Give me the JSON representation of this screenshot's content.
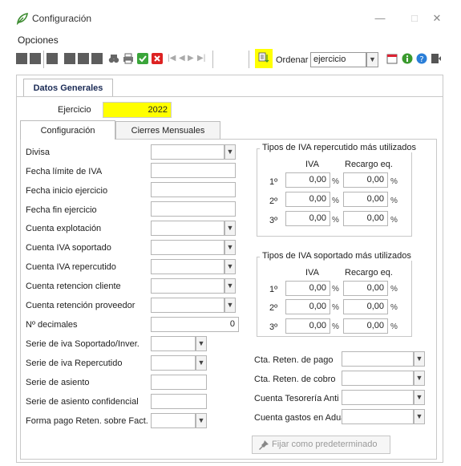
{
  "window": {
    "title": "Configuración",
    "minimize": "—",
    "maximize": "□",
    "close": "✕"
  },
  "menu": {
    "opciones": "Opciones"
  },
  "toolbar": {
    "ordenar_label": "Ordenar",
    "ordenar_value": "ejercicio",
    "highlight_color": "#ffff00"
  },
  "tabs": {
    "datos_generales": "Datos Generales",
    "configuracion": "Configuración",
    "cierres_mensuales": "Cierres Mensuales"
  },
  "ejercicio": {
    "label": "Ejercicio",
    "value": "2022"
  },
  "fields": [
    {
      "label": "Divisa",
      "value": "",
      "kind": "combo"
    },
    {
      "label": "Fecha límite de IVA",
      "value": "",
      "kind": "text"
    },
    {
      "label": "Fecha inicio ejercicio",
      "value": "",
      "kind": "text"
    },
    {
      "label": "Fecha fin ejercicio",
      "value": "",
      "kind": "text"
    },
    {
      "label": "Cuenta explotación",
      "value": "",
      "kind": "combo"
    },
    {
      "label": "Cuenta IVA soportado",
      "value": "",
      "kind": "combo"
    },
    {
      "label": "Cuenta IVA repercutido",
      "value": "",
      "kind": "combo"
    },
    {
      "label": "Cuenta retencion cliente",
      "value": "",
      "kind": "combo"
    },
    {
      "label": "Cuenta retención proveedor",
      "value": "",
      "kind": "combo"
    },
    {
      "label": "Nº decimales",
      "value": "0",
      "kind": "number"
    }
  ],
  "series": [
    {
      "label": "Serie de iva Soportado/Inver.",
      "value": "",
      "kind": "combo"
    },
    {
      "label": "Serie de iva Repercutido",
      "value": "",
      "kind": "combo"
    },
    {
      "label": "Serie de asiento",
      "value": "",
      "kind": "text"
    },
    {
      "label": "Serie de asiento confidencial",
      "value": "",
      "kind": "text"
    },
    {
      "label": "Forma pago Reten. sobre Fact.",
      "value": "",
      "kind": "combo"
    }
  ],
  "iva_repercutido": {
    "title": "Tipos de IVA repercutido más utilizados",
    "col_iva": "IVA",
    "col_recargo": "Recargo eq.",
    "rows": [
      {
        "label": "1º",
        "iva": "0,00",
        "recargo": "0,00"
      },
      {
        "label": "2º",
        "iva": "0,00",
        "recargo": "0,00"
      },
      {
        "label": "3º",
        "iva": "0,00",
        "recargo": "0,00"
      }
    ],
    "pct": "%"
  },
  "iva_soportado": {
    "title": "Tipos de IVA soportado más utilizados",
    "col_iva": "IVA",
    "col_recargo": "Recargo eq.",
    "rows": [
      {
        "label": "1º",
        "iva": "0,00",
        "recargo": "0,00"
      },
      {
        "label": "2º",
        "iva": "0,00",
        "recargo": "0,00"
      },
      {
        "label": "3º",
        "iva": "0,00",
        "recargo": "0,00"
      }
    ],
    "pct": "%"
  },
  "right_fields": [
    {
      "label": "Cta. Reten. de pago",
      "value": ""
    },
    {
      "label": "Cta. Reten. de cobro",
      "value": ""
    },
    {
      "label": "Cuenta Tesorería Anticipos",
      "value": ""
    },
    {
      "label": "Cuenta gastos en Aduana",
      "value": ""
    }
  ],
  "fijar_button": "Fijar como predeterminado"
}
